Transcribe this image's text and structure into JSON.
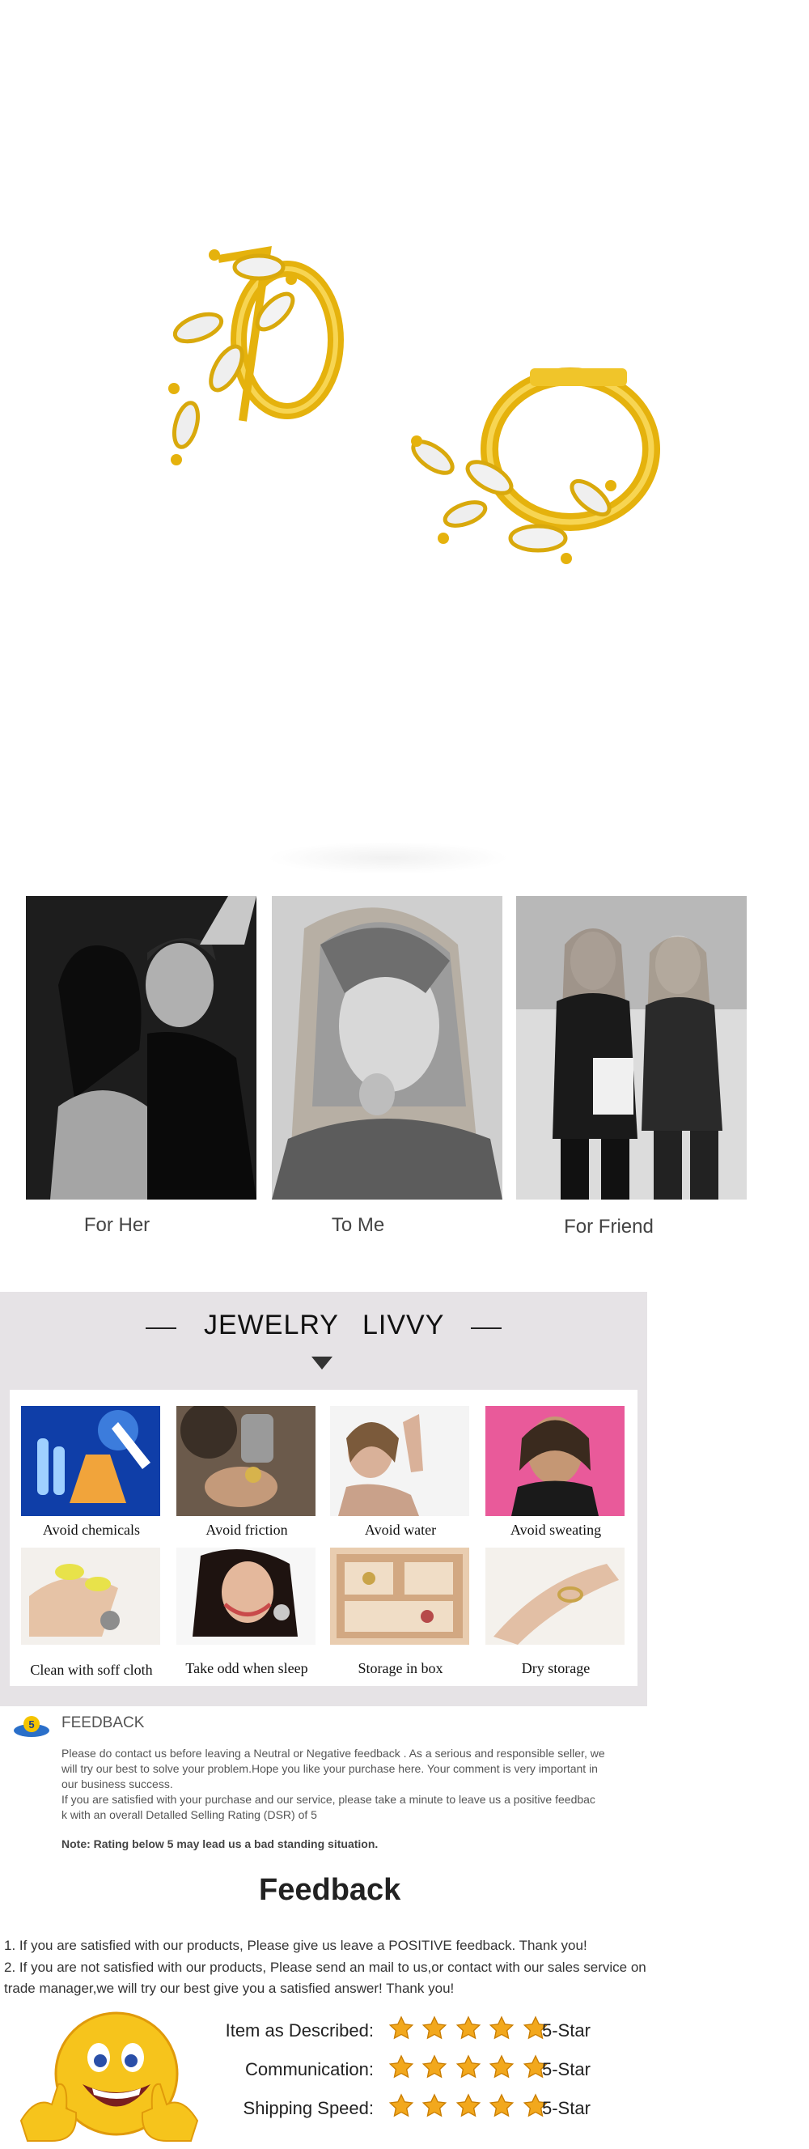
{
  "gifts": [
    {
      "caption": "For Her"
    },
    {
      "caption": "To Me"
    },
    {
      "caption": "For Friend"
    }
  ],
  "care": {
    "title_left": "JEWELRY",
    "title_right": "LIVVY",
    "items": [
      {
        "label": "Avoid chemicals",
        "icon": "lab-flask"
      },
      {
        "label": "Avoid friction",
        "icon": "polishing-tool"
      },
      {
        "label": "Avoid water",
        "icon": "water-splash"
      },
      {
        "label": "Avoid sweating",
        "icon": "sweating-woman"
      },
      {
        "label": "Clean with soff cloth",
        "icon": "cleaning-cloth"
      },
      {
        "label": "Take odd when sleep",
        "icon": "sleeping-woman"
      },
      {
        "label": "Storage in box",
        "icon": "jewelry-box"
      },
      {
        "label": "Dry storage",
        "icon": "ring-on-hand"
      }
    ]
  },
  "feedback": {
    "badge": "5",
    "heading": "FEEDBACK",
    "para1_line1": "Please do contact us before leaving a Neutral or Negative  feedback . As a serious and responsible seller, we",
    "para1_line2": "will try our best to solve your problem.Hope you like your purchase here. Your comment is very important in",
    "para1_line3": "our business success.",
    "para2_line1": " If you are satisfied with your purchase and our service,  please take a minute to leave us  a positive feedbac",
    "para2_line2": "k with an overall  Detalled Selling Rating (DSR) of 5",
    "note": "Note: Rating below 5 may lead us a bad standing situation.",
    "title": "Feedback",
    "line1": "1. If you are satisfied with our products, Please give us leave a POSITIVE feedback. Thank you!",
    "line2a": "2. If you are not satisfied with our products, Please send an mail to us,or contact with our sales service on",
    "line2b": "trade manager,we will try our best give you a satisfied answer! Thank you!"
  },
  "ratings": [
    {
      "label": "Item as Described:",
      "stars": 5,
      "value": "5-Star"
    },
    {
      "label": "Communication:",
      "stars": 5,
      "value": "5-Star"
    },
    {
      "label": "Shipping Speed:",
      "stars": 5,
      "value": "5-Star"
    }
  ],
  "colors": {
    "gold": "#e9b70f",
    "star": "#f2a81d",
    "panel": "#e6e3e6"
  }
}
